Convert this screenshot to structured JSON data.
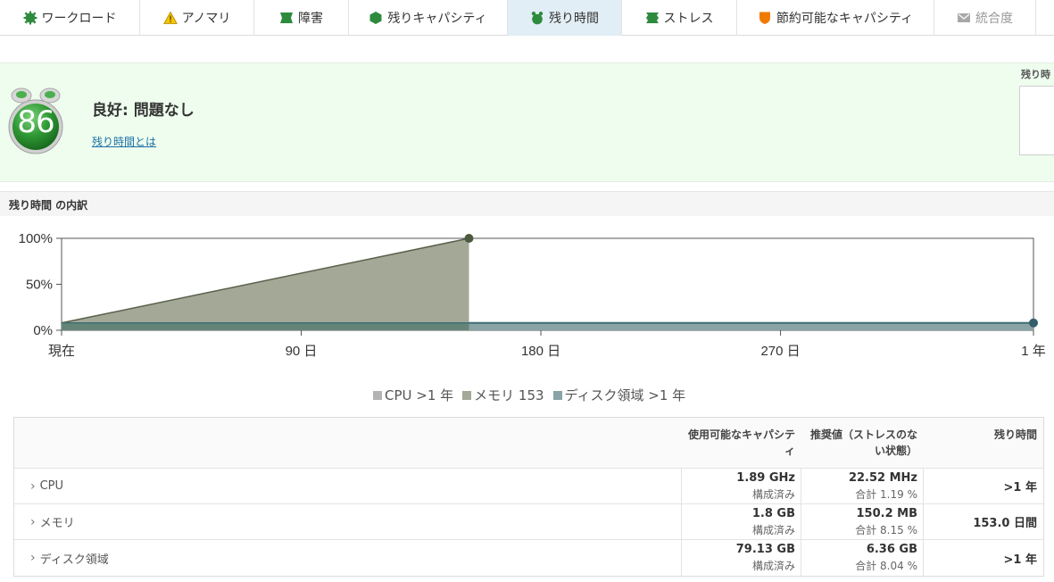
{
  "tabs": [
    {
      "label": "ワークロード",
      "icon": "workload-gear-icon",
      "color": "#2e8b3e"
    },
    {
      "label": "アノマリ",
      "icon": "warning-triangle-icon",
      "color": "#f2c200"
    },
    {
      "label": "障害",
      "icon": "health-badge-icon",
      "color": "#2e8b3e"
    },
    {
      "label": "残りキャパシティ",
      "icon": "capacity-hexagon-icon",
      "color": "#2e8b3e"
    },
    {
      "label": "残り時間",
      "icon": "time-remaining-icon",
      "color": "#2e8b3e",
      "active": true
    },
    {
      "label": "ストレス",
      "icon": "stress-badge-icon",
      "color": "#2e8b3e"
    },
    {
      "label": "節約可能なキャパシティ",
      "icon": "reclaimable-shield-icon",
      "color": "#f07a00"
    },
    {
      "label": "統合度",
      "icon": "density-envelope-icon",
      "color": "#a0a0a0",
      "disabled": true
    }
  ],
  "summary": {
    "score": "86",
    "status": "良好: 問題なし",
    "link": "残り時間とは",
    "side_label": "残り時"
  },
  "breakdown": {
    "title": "残り時間 の内訳"
  },
  "chart_data": {
    "type": "area",
    "y_ticks": [
      "100%",
      "50%",
      "0%"
    ],
    "x_ticks": [
      "現在",
      "90 日",
      "180 日",
      "270 日",
      "1 年"
    ],
    "ylim": [
      0,
      100
    ],
    "xlim_days": [
      0,
      365
    ],
    "series": [
      {
        "name": "CPU >1 年",
        "color": "#b3b3b3",
        "points": [
          [
            0,
            8
          ],
          [
            365,
            8
          ]
        ]
      },
      {
        "name": "メモリ 153",
        "color": "#a3a897",
        "points": [
          [
            0,
            8
          ],
          [
            153,
            100
          ]
        ]
      },
      {
        "name": "ディスク領域 >1 年",
        "color": "#8aa3a7",
        "points": [
          [
            0,
            8
          ],
          [
            365,
            8
          ]
        ]
      }
    ]
  },
  "table": {
    "headers": [
      "",
      "使用可能なキャパシティ",
      "推奨値（ストレスのない状態）",
      "残り時間"
    ],
    "rows": [
      {
        "name": "CPU",
        "capacity": "1.89 GHz",
        "capacity_sub": "構成済み",
        "recommended": "22.52 MHz",
        "recommended_sub": "合計 1.19 %",
        "remaining": ">1 年"
      },
      {
        "name": "メモリ",
        "capacity": "1.8 GB",
        "capacity_sub": "構成済み",
        "recommended": "150.2 MB",
        "recommended_sub": "合計 8.15 %",
        "remaining": "153.0 日間"
      },
      {
        "name": "ディスク領域",
        "capacity": "79.13 GB",
        "capacity_sub": "構成済み",
        "recommended": "6.36 GB",
        "recommended_sub": "合計 8.04 %",
        "remaining": ">1 年"
      }
    ]
  }
}
